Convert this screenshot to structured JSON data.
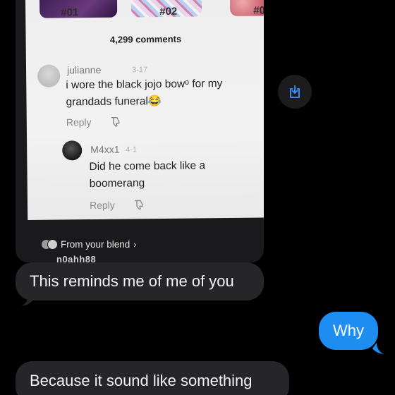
{
  "shared_post": {
    "thumbnails": [
      {
        "number": "#01"
      },
      {
        "number": "#02"
      },
      {
        "number": "#0"
      }
    ],
    "comments_count": "4,299 comments",
    "comments": [
      {
        "user": "julianne",
        "meta": "3-17",
        "text_line1": "i wore the black jojo bowᵒ for my",
        "text_line2": "grandads funeral😂",
        "reply_label": "Reply"
      },
      {
        "user": "M4xx1",
        "meta": "4-1",
        "text_line1": "Did he come back like a",
        "text_line2": "boomerang",
        "reply_label": "Reply"
      }
    ],
    "blend_label": "From your blend",
    "handle_partial": "n0ahh88"
  },
  "share_button": {
    "icon": "download-share-icon"
  },
  "messages": [
    {
      "direction": "incoming",
      "text": "This reminds me of me of you"
    },
    {
      "direction": "outgoing",
      "text": "Why"
    },
    {
      "direction": "incoming",
      "text": "Because it sound like something"
    }
  ],
  "colors": {
    "background": "#000000",
    "incoming_bubble": "#262629",
    "outgoing_bubble": "#1d8df2",
    "share_icon": "#2f8cf5"
  }
}
